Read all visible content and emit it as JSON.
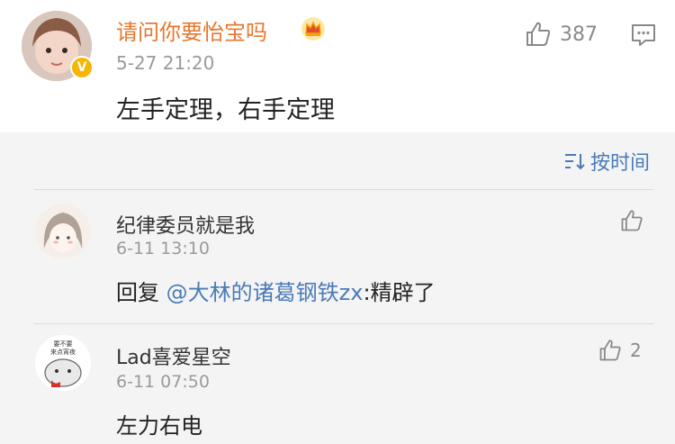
{
  "post": {
    "username": "请问你要怡宝吗",
    "timestamp": "5-27 21:20",
    "text": "左手定理，右手定理",
    "like_count": "387",
    "badge": "V"
  },
  "sort": {
    "label": "按时间"
  },
  "comments": [
    {
      "username": "纪律委员就是我",
      "timestamp": "6-11 13:10",
      "reply_prefix": "回复 ",
      "mention": "@大林的诸葛钢铁zx",
      "reply_suffix": ":精辟了",
      "like_count": ""
    },
    {
      "username": "Lad喜爱星空",
      "timestamp": "6-11 07:50",
      "text": "左力右电",
      "like_count": "2",
      "avatar_caption": [
        "要不要",
        "来点宵夜"
      ]
    }
  ],
  "colors": {
    "username_orange": "#e8772e",
    "link_blue": "#4a7bb7",
    "meta_gray": "#9a9a9a"
  }
}
